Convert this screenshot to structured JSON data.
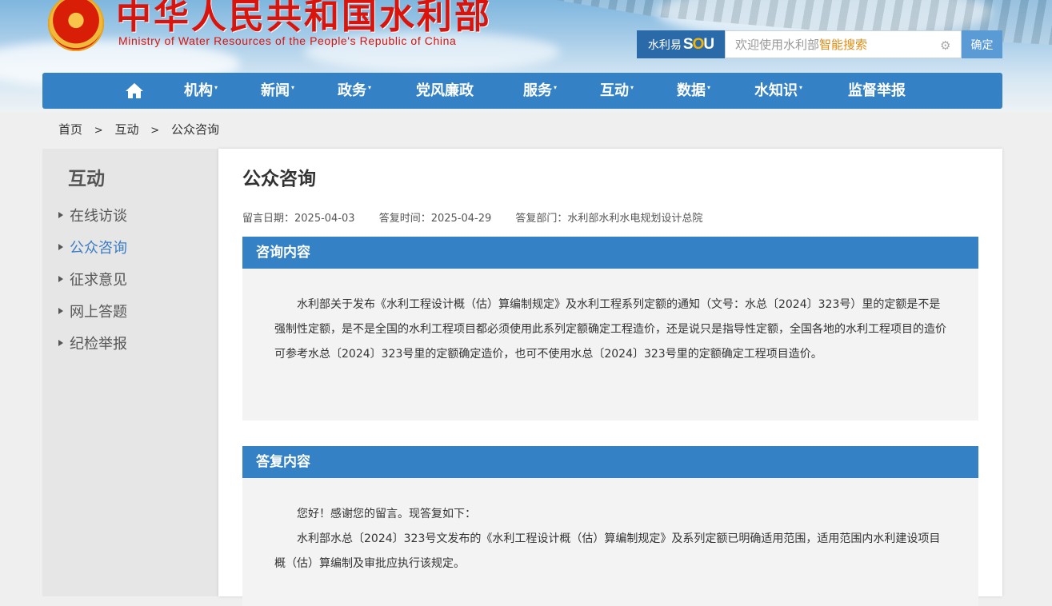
{
  "header": {
    "title": "中华人民共和国水利部",
    "subtitle": "Ministry of Water Resources of the People's Republic of China"
  },
  "search": {
    "brand_prefix": "水利易",
    "brand_logo": "SOU",
    "placeholder_prefix": "欢迎使用水利部",
    "placeholder_highlight": "智能搜索",
    "settings_icon": "gear-icon",
    "submit_label": "确定"
  },
  "nav": {
    "home_icon": "home-icon",
    "items": [
      {
        "label": "机构",
        "dropdown": true
      },
      {
        "label": "新闻",
        "dropdown": true
      },
      {
        "label": "政务",
        "dropdown": true
      },
      {
        "label": "党风廉政",
        "dropdown": false
      },
      {
        "label": "服务",
        "dropdown": true
      },
      {
        "label": "互动",
        "dropdown": true
      },
      {
        "label": "数据",
        "dropdown": true
      },
      {
        "label": "水知识",
        "dropdown": true
      },
      {
        "label": "监督举报",
        "dropdown": false
      }
    ],
    "caret": "▾"
  },
  "breadcrumb": {
    "items": [
      "首页",
      "互动",
      "公众咨询"
    ],
    "separator": ">"
  },
  "sidebar": {
    "title": "互动",
    "items": [
      {
        "label": "在线访谈"
      },
      {
        "label": "公众咨询"
      },
      {
        "label": "征求意见"
      },
      {
        "label": "网上答题"
      },
      {
        "label": "纪检举报"
      }
    ],
    "active_index": 1
  },
  "main": {
    "title": "公众咨询",
    "meta": {
      "message_date": "留言日期：2025-04-03",
      "reply_time": "答复时间：2025-04-29",
      "reply_dept": "答复部门：水利部水利水电规划设计总院"
    },
    "question": {
      "heading": "咨询内容",
      "paragraphs": [
        "水利部关于发布《水利工程设计概（估）算编制规定》及水利工程系列定额的通知（文号：水总〔2024〕323号）里的定额是不是强制性定额，是不是全国的水利工程项目都必须使用此系列定额确定工程造价，还是说只是指导性定额，全国各地的水利工程项目的造价可参考水总〔2024〕323号里的定额确定造价，也可不使用水总〔2024〕323号里的定额确定工程项目造价。"
      ]
    },
    "answer": {
      "heading": "答复内容",
      "paragraphs": [
        "您好！感谢您的留言。现答复如下：",
        "水利部水总〔2024〕323号文发布的《水利工程设计概（估）算编制规定》及系列定额已明确适用范围，适用范围内水利建设项目概（估）算编制及审批应执行该规定。"
      ]
    }
  },
  "colors": {
    "brand_blue": "#3482c5",
    "title_red": "#d8140c",
    "search_highlight": "#e38b12",
    "active_link": "#3c7dc4"
  }
}
